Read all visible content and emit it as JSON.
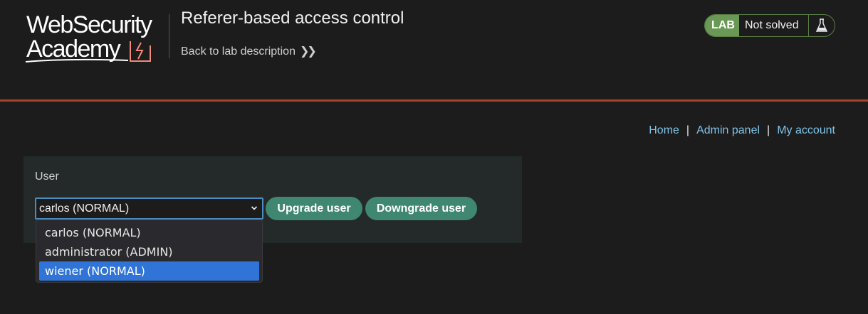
{
  "header": {
    "logo": {
      "line1": "WebSecurity",
      "line2": "Academy"
    },
    "lab_title": "Referer-based access control",
    "back_link": "Back to lab description",
    "status": {
      "badge": "LAB",
      "text": "Not solved",
      "icon": "flask-icon"
    }
  },
  "nav": {
    "items": [
      "Home",
      "Admin panel",
      "My account"
    ],
    "separator": "|"
  },
  "form": {
    "user_label": "User",
    "selected_value": "carlos (NORMAL)",
    "upgrade_label": "Upgrade user",
    "downgrade_label": "Downgrade user",
    "options": [
      "carlos (NORMAL)",
      "administrator (ADMIN)",
      "wiener (NORMAL)"
    ],
    "highlighted_option": "wiener (NORMAL)"
  },
  "colors": {
    "accent_rule": "#a8432a",
    "link": "#7fc4e8",
    "button": "#3f8770",
    "status_green": "#6a9955",
    "option_highlight": "#2f74d6"
  }
}
